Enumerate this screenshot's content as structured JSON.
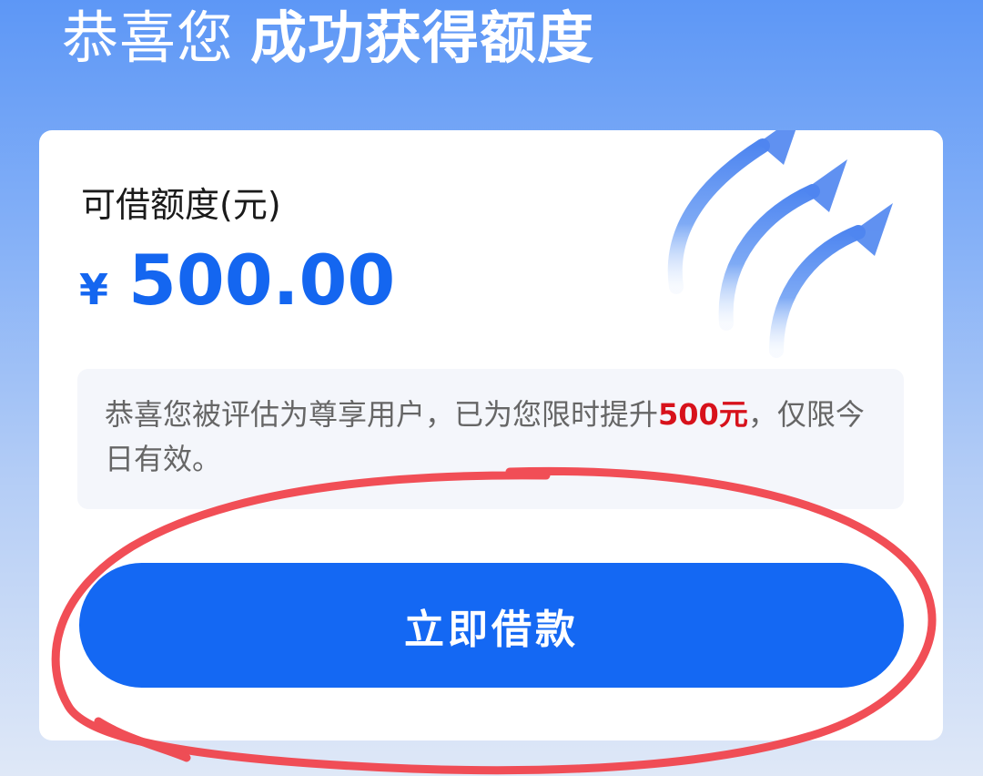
{
  "header": {
    "greeting": "恭喜您",
    "headline": "成功获得额度"
  },
  "card": {
    "label": "可借额度(元)",
    "currency_symbol": "¥",
    "amount": "500.00",
    "notice": {
      "before": "恭喜您被评估为尊享用户，已为您限时提升",
      "highlight": "500元",
      "after": "，仅限今日有效。"
    },
    "cta_label": "立即借款",
    "decoration_icon": "rising-arrows-icon"
  },
  "colors": {
    "accent": "#1468f3",
    "amount": "#1466f0",
    "highlight": "#d7121b",
    "annotation": "#f0454d"
  }
}
